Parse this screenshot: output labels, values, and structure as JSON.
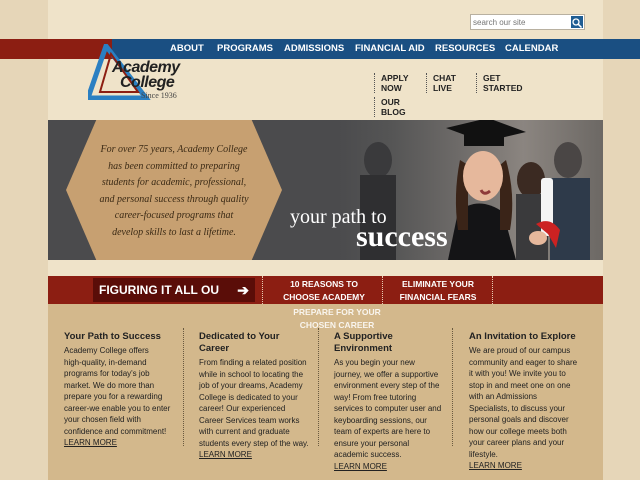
{
  "search": {
    "placeholder": "search our site"
  },
  "nav": [
    "ABOUT",
    "PROGRAMS",
    "ADMISSIONS",
    "FINANCIAL AID",
    "RESOURCES",
    "CALENDAR"
  ],
  "logo": {
    "line1": "Academy",
    "line2": "College",
    "since": "Since 1936"
  },
  "quick_links": {
    "apply_1": "APPLY",
    "apply_2": "NOW",
    "chat_1": "CHAT",
    "chat_2": "LIVE",
    "start_1": "GET",
    "start_2": "STARTED",
    "blog_1": "OUR",
    "blog_2": "BLOG"
  },
  "hero": {
    "intro_lines": [
      "For over 75 years, Academy College",
      "has been committed to preparing",
      "students for academic, professional,",
      "and personal success through quality",
      "career-focused programs that",
      "develop skills to last a lifetime."
    ],
    "tagline_1": "your path to",
    "tagline_2": "success"
  },
  "banner": {
    "figuring": "FIGURING IT ALL OU",
    "reasons_1": "10 REASONS TO",
    "reasons_2": "CHOOSE ACADEMY",
    "fears_1": "ELIMINATE YOUR",
    "fears_2": "FINANCIAL FEARS",
    "ghost_1": "PREPARE FOR YOUR",
    "ghost_2": "CHOSEN CAREER"
  },
  "columns": [
    {
      "title": "Your Path to Success",
      "lines": [
        "Academy College offers",
        "high-quality, in-demand",
        "programs for today's job",
        "market.  We do more than",
        "prepare you for a rewarding",
        "career-we enable you to enter",
        "your chosen field with",
        "confidence and commitment!"
      ],
      "more": "LEARN MORE"
    },
    {
      "title_1": "Dedicated to Your",
      "title_2": "Career",
      "lines": [
        "From finding a related position",
        "while in school to locating the",
        "job of your dreams, Academy",
        "College is dedicated to your",
        "career!  Our experienced",
        "Career Services team works",
        "with current and graduate",
        "students every step of the way."
      ],
      "more": "LEARN MORE"
    },
    {
      "title_1": "A Supportive",
      "title_2": "Environment",
      "lines": [
        "As you begin your new",
        "journey, we offer a supportive",
        "environment every step of the",
        "way!  From free tutoring",
        "services to computer user and",
        "keyboarding sessions, our",
        "team of experts are here to",
        "ensure your personal",
        "academic success."
      ],
      "more": "LEARN MORE"
    },
    {
      "title": "An Invitation to Explore",
      "lines": [
        "We are proud of our campus",
        "community and eager to share",
        "it with you!  We invite you to",
        "stop in and meet one on one",
        "with an Admissions",
        "Specialists, to discuss your",
        "personal goals and discover",
        "how our college meets both",
        "your career plans and your",
        "lifestyle."
      ],
      "more": "LEARN MORE"
    }
  ]
}
